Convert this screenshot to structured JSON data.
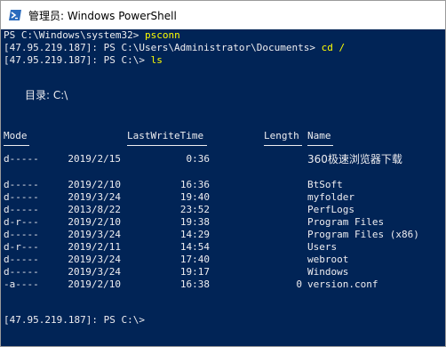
{
  "window": {
    "title": "管理员: Windows PowerShell",
    "icon": "powershell-icon"
  },
  "console": {
    "line1_prompt": "PS C:\\Windows\\system32> ",
    "line1_cmd": "psconn",
    "line2_prompt": "[47.95.219.187]: PS C:\\Users\\Administrator\\Documents> ",
    "line2_cmd": "cd /",
    "line3_prompt": "[47.95.219.187]: PS C:\\> ",
    "line3_cmd": "ls",
    "dir_header": "目录: C:\\",
    "columns": {
      "mode": "Mode",
      "lastwrite": "LastWriteTime",
      "length": "Length",
      "name": "Name"
    },
    "rows": [
      {
        "mode": "d-----",
        "date": "2019/2/15",
        "time": "0:36",
        "length": "",
        "name": "360极速浏览器下载"
      },
      {
        "mode": "d-----",
        "date": "2019/2/10",
        "time": "16:36",
        "length": "",
        "name": "BtSoft"
      },
      {
        "mode": "d-----",
        "date": "2019/3/24",
        "time": "19:40",
        "length": "",
        "name": "myfolder"
      },
      {
        "mode": "d-----",
        "date": "2013/8/22",
        "time": "23:52",
        "length": "",
        "name": "PerfLogs"
      },
      {
        "mode": "d-r---",
        "date": "2019/2/10",
        "time": "19:38",
        "length": "",
        "name": "Program Files"
      },
      {
        "mode": "d-----",
        "date": "2019/3/24",
        "time": "14:29",
        "length": "",
        "name": "Program Files (x86)"
      },
      {
        "mode": "d-r---",
        "date": "2019/2/11",
        "time": "14:54",
        "length": "",
        "name": "Users"
      },
      {
        "mode": "d-----",
        "date": "2019/3/24",
        "time": "17:40",
        "length": "",
        "name": "webroot"
      },
      {
        "mode": "d-----",
        "date": "2019/3/24",
        "time": "19:17",
        "length": "",
        "name": "Windows"
      },
      {
        "mode": "-a----",
        "date": "2019/2/10",
        "time": "16:38",
        "length": "0",
        "name": "version.conf"
      }
    ],
    "final_prompt": "[47.95.219.187]: PS C:\\>"
  },
  "colors": {
    "background": "#012456",
    "text": "#eeedf0",
    "command": "#ffff00"
  }
}
